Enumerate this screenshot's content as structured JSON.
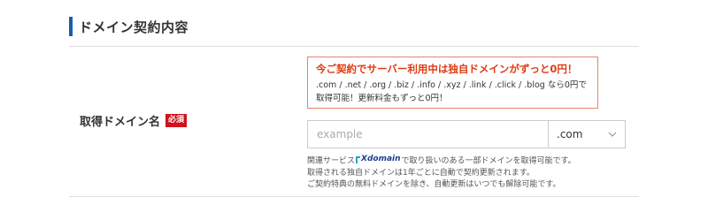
{
  "section": {
    "title": "ドメイン契約内容"
  },
  "row": {
    "label": "取得ドメイン名",
    "required_badge": "必須"
  },
  "promo": {
    "title": "今ご契約でサーバー利用中は独自ドメインがずっと0円！",
    "body": ".com / .net / .org / .biz / .info / .xyz / .link / .click / .blog なら0円で取得可能！更新料金もずっと0円！"
  },
  "domain_input": {
    "value": "",
    "placeholder": "example"
  },
  "tld_select": {
    "selected": ".com",
    "icon": "chevron-down-icon"
  },
  "notes": {
    "line1_prefix": "関連サービス",
    "logo_text": "Xdomain",
    "line1_suffix": "で取り扱いのある一部ドメインを取得可能です。",
    "line2": "取得される独自ドメインは1年ごとに自動で契約更新されます。",
    "line3": "ご契約特典の無料ドメインを除き、自動更新はいつでも解除可能です。"
  },
  "colors": {
    "section_bar": "#1a5fa8",
    "badge": "#d0121b",
    "promo_border": "#e8826a",
    "promo_title": "#e03a14",
    "logo_text": "#1b3f8b",
    "logo_mark": "#2a9fd8"
  }
}
